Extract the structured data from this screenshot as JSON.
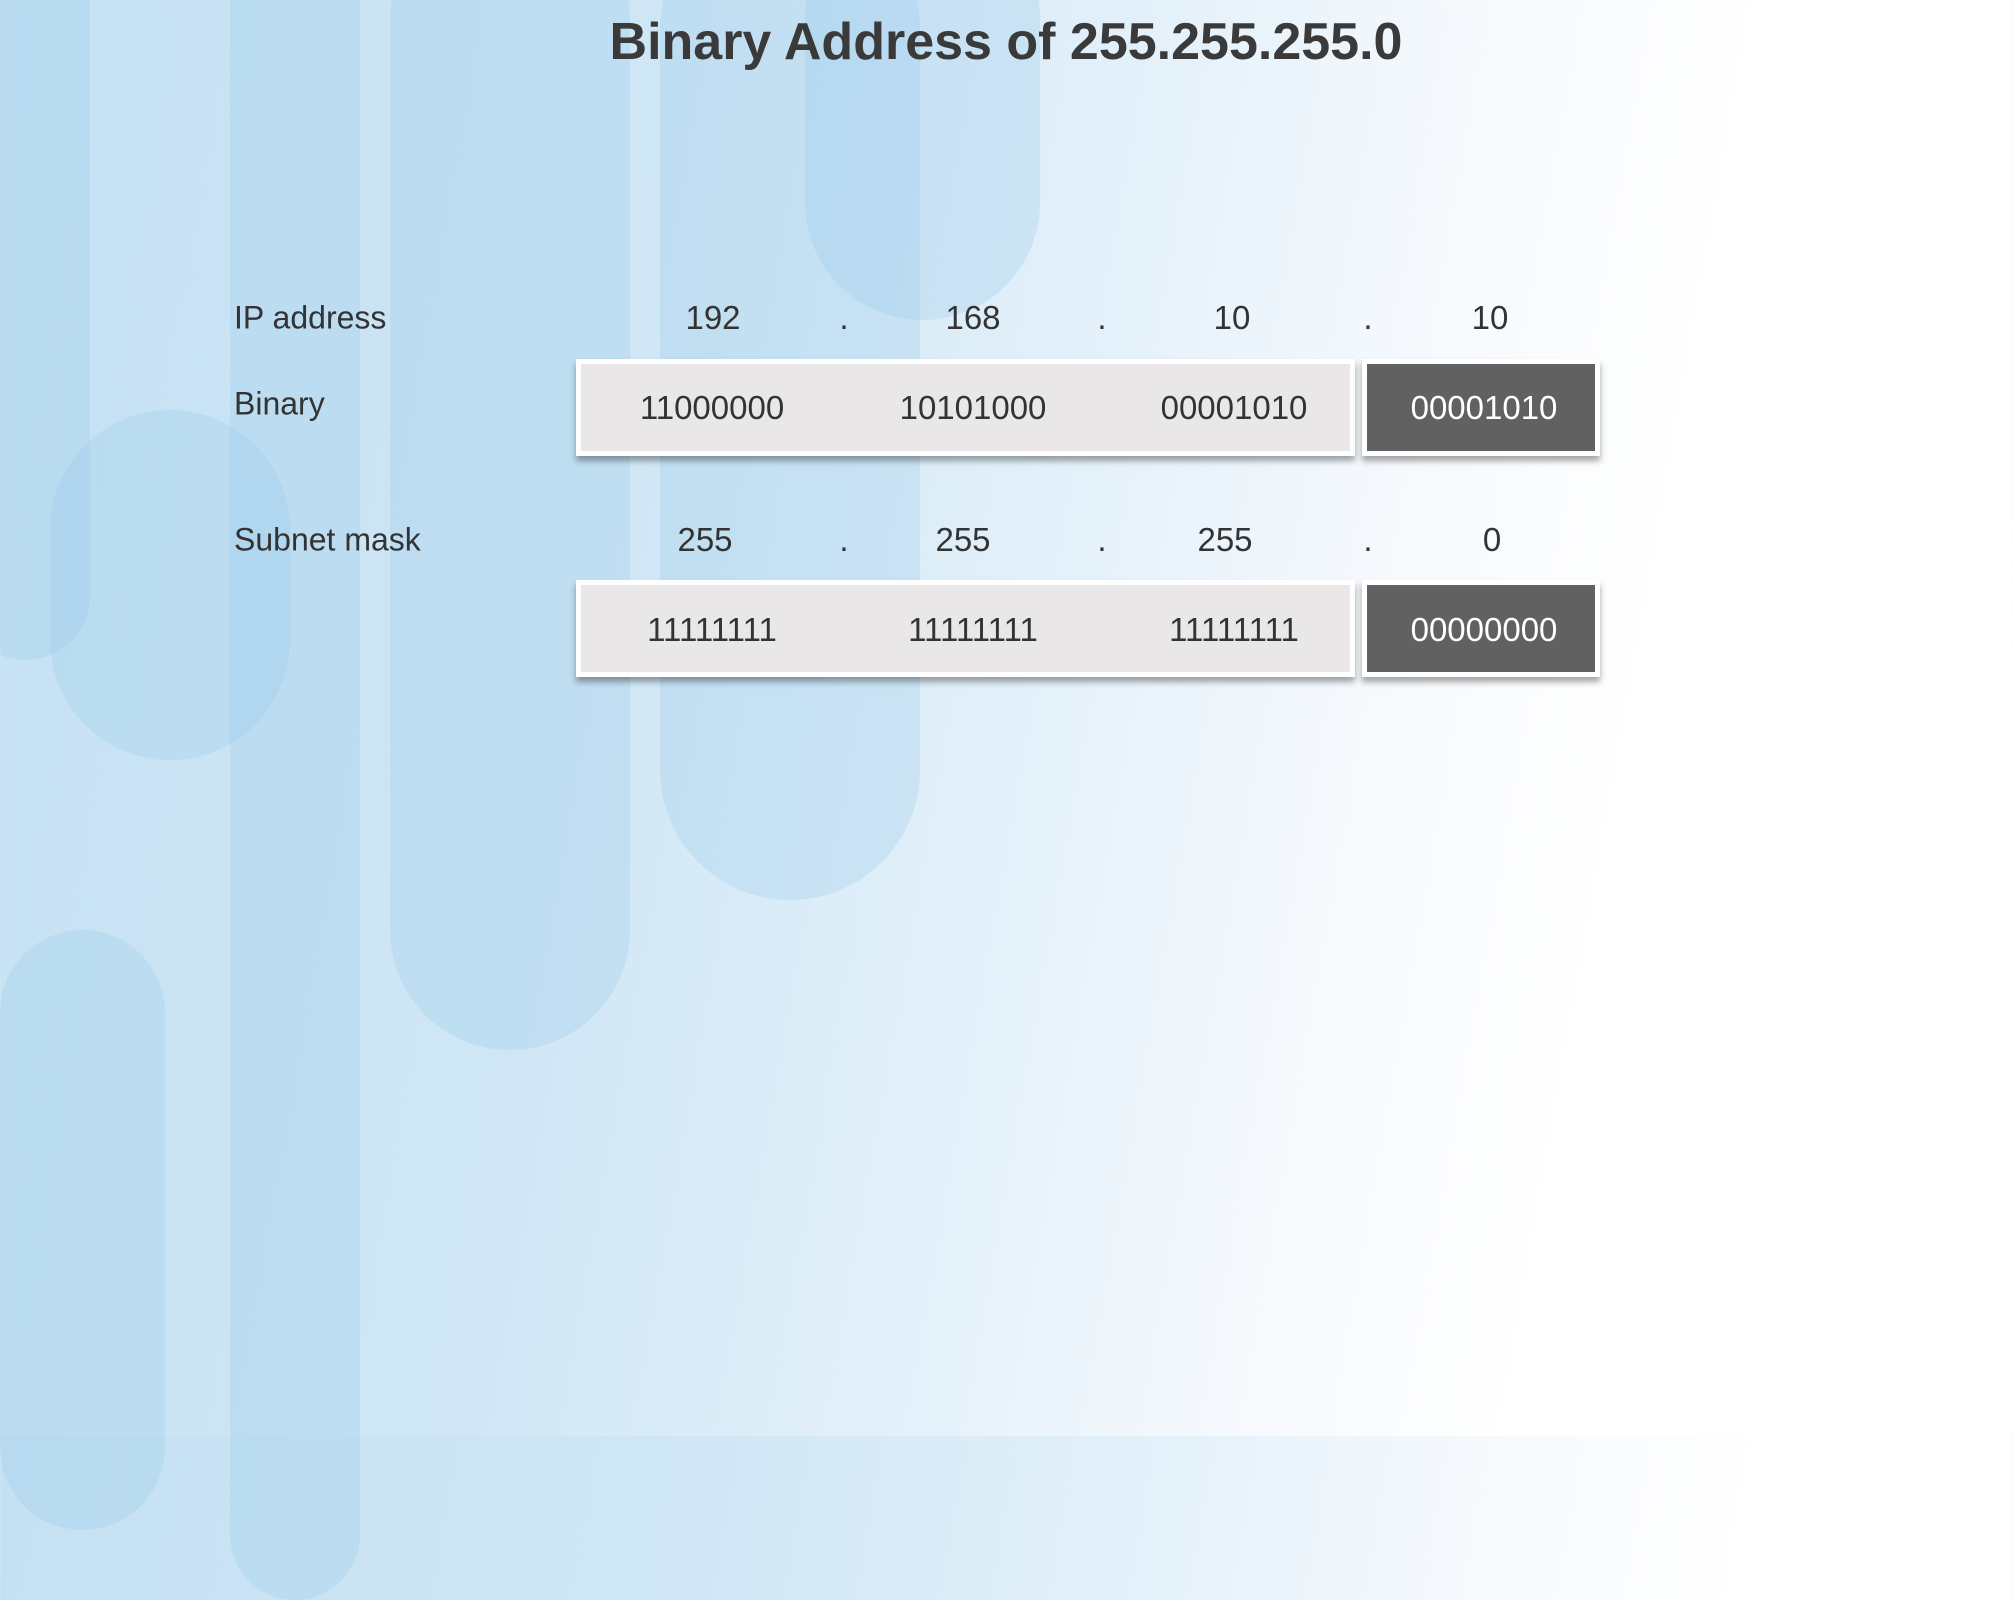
{
  "title": "Binary Address of 255.255.255.0",
  "ip": {
    "label": "IP address",
    "octets": [
      "192",
      "168",
      "10",
      "10"
    ],
    "dot": ".",
    "binary_label": "Binary",
    "binary": [
      "11000000",
      "10101000",
      "00001010",
      "00001010"
    ]
  },
  "mask": {
    "label": "Subnet mask",
    "octets": [
      "255",
      "255",
      "255",
      "0"
    ],
    "dot": ".",
    "binary": [
      "11111111",
      "11111111",
      "11111111",
      "00000000"
    ]
  },
  "colors": {
    "box": "#e9e7e7",
    "highlight": "#626161"
  }
}
